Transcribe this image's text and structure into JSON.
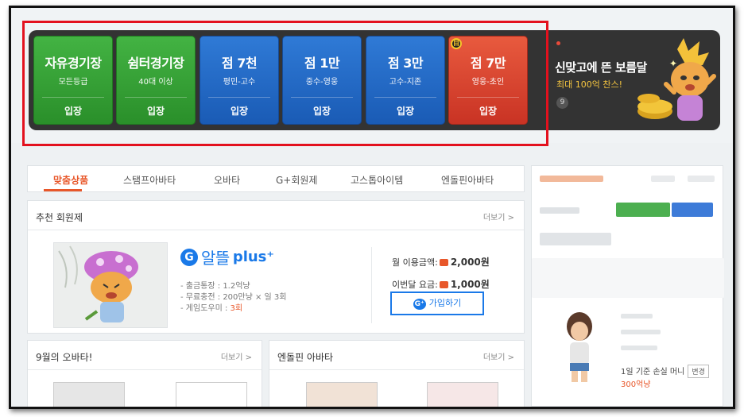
{
  "rooms": [
    {
      "title": "자유경기장",
      "sub": "모든등급",
      "enter": "입장",
      "color": "green"
    },
    {
      "title": "쉼터경기장",
      "sub": "40대 이상",
      "enter": "입장",
      "color": "green"
    },
    {
      "title": "점 7천",
      "sub": "평민-고수",
      "enter": "입장",
      "color": "blue"
    },
    {
      "title": "점 1만",
      "sub": "중수-영웅",
      "enter": "입장",
      "color": "blue"
    },
    {
      "title": "점 3만",
      "sub": "고수-지존",
      "enter": "입장",
      "color": "blue"
    },
    {
      "title": "점 7만",
      "sub": "영웅-초인",
      "enter": "입장",
      "color": "red",
      "badge": "目"
    }
  ],
  "banner": {
    "headline": "신맞고에 뜬 보름달",
    "subline": "최대 100억 찬스!",
    "number": "9"
  },
  "tabs": [
    "맞춤상품",
    "스탬프아바타",
    "오바타",
    "G+회원제",
    "고스톱아이템",
    "엔돌핀아바타"
  ],
  "active_tab": 0,
  "recommend": {
    "title": "추천 회원제",
    "more": "더보기 >",
    "logo_g": "G",
    "logo_name": "알뜰",
    "logo_plus": "plus⁺",
    "features": [
      "- 출금통장 : 1.2억냥",
      "- 무료충전 : 200만냥 × 일 3회",
      "- 게임도우미 : "
    ],
    "helper_count": "3회",
    "price_monthly_label": "월 이용금액:",
    "price_monthly": "2,000원",
    "price_this_label": "이번달 요금:",
    "price_this": "1,000원",
    "join_icon": "G⁺",
    "join_label": "가입하기"
  },
  "obata_card": {
    "title": "9월의 오바타!",
    "more": "더보기 >"
  },
  "endolphin_card": {
    "title": "엔돌핀 아바타",
    "more": "더보기 >"
  },
  "side": {
    "daily_loss_label": "1일 기준 손실 머니",
    "change_button": "변경",
    "daily_money": "300억냥"
  },
  "colors": {
    "accent": "#e8572a",
    "blue": "#1a79e8",
    "green": "#2a8f2a",
    "red": "#c93324",
    "highlight": "#e3111e"
  }
}
